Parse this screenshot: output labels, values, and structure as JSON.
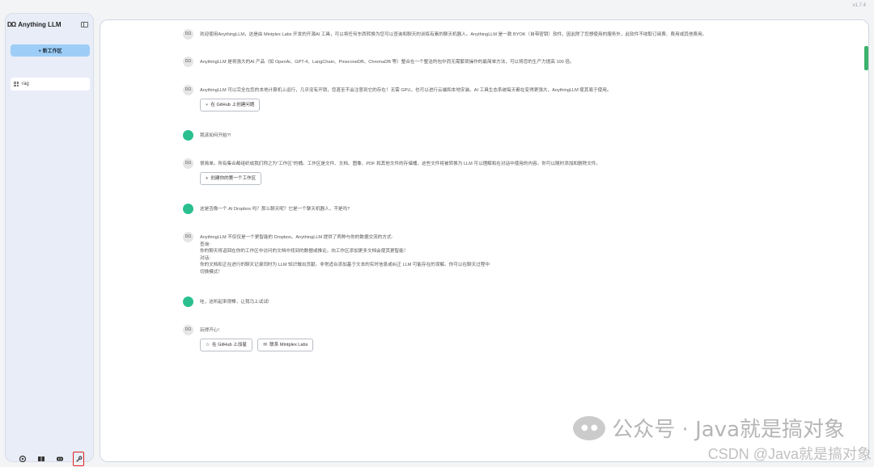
{
  "version": "v1.7.4",
  "brand": {
    "logo_glyph": "DΩ",
    "name": "Anything LLM"
  },
  "sidebar": {
    "new_workspace": "+ 新工作区",
    "workspaces": [
      {
        "name": "rag"
      }
    ],
    "bottom_icons": [
      "community-icon",
      "docs-icon",
      "discord-icon",
      "settings-wrench-icon"
    ]
  },
  "messages": [
    {
      "role": "ai",
      "avatar_text": "DΩ",
      "text": "欢迎使用AnythingLLM，这是由 Mintplex Labs 开发的开源AI 工具，可以将任何东西转换为您可以查询和聊天的训练有素的聊天机器人。AnythingLLM 是一款 BYOK（自带密钥）软件，因此除了您想使用的服务外，此软件不收取订阅费、费用或其他费用。"
    },
    {
      "role": "ai",
      "avatar_text": "DΩ",
      "text": "AnythingLLM 是将强大的AI 产品（如 OpenAi、GPT-4、LangChain、PineconeDB、ChromaDB 等）整合在一个整洁的包中而无需繁琐操作的最简单方法，可以将您的生产力提高 100 倍。"
    },
    {
      "role": "ai",
      "avatar_text": "DΩ",
      "text": "AnythingLLM 可以完全在您的本地计算机上运行，几乎没有开销，您甚至不会注意到它的存在！无需 GPU，也可以进行云端和本地安装。AI 工具生态系统每天都在变得更强大，AnythingLLM 使其易于使用。",
      "buttons": [
        {
          "icon": "⑂",
          "label": "在 GitHub 上创建问题"
        }
      ]
    },
    {
      "role": "user",
      "avatar_text": "",
      "text": "我该如何开始?!"
    },
    {
      "role": "ai",
      "avatar_text": "DΩ",
      "text": "很简单。所有集合都组织成我们称之为\"工作区\"的桶。工作区是文件、文档、图像、PDF 和其他文件的存储桶，这些文件将被转换为 LLM 可以理解和在对话中使用的内容。你可以随时添加和删除文件。",
      "buttons": [
        {
          "icon": "+",
          "label": "创建你的第一个工作区"
        }
      ]
    },
    {
      "role": "user",
      "avatar_text": "",
      "text": "这是否像一个 AI Dropbox 吗？那么聊天呢？它是一个聊天机器人，不是吗?"
    },
    {
      "role": "ai",
      "avatar_text": "DΩ",
      "lines": [
        "AnythingLLM 不仅仅是一个更智能的 Dropbox。AnythingLLM 提供了两种与你的数据交流的方式:",
        "查询:",
        "你的聊天将返回在你的工作区中访问的文档中找到的数据或推论。向工作区添加更多文档会使其更智能！",
        "对话:",
        "你的文档和正在进行的聊天记录同时为 LLM 知识做出贡献。非常适合添加基于文本的实时信息或纠正 LLM 可能存在的误解。你可以在聊天过程中",
        "切换模式！"
      ]
    },
    {
      "role": "user",
      "avatar_text": "",
      "text": "哇，这听起来很棒，让我马上试试!"
    },
    {
      "role": "ai",
      "avatar_text": "DΩ",
      "text": "玩得开心!",
      "buttons": [
        {
          "icon": "☆",
          "label": "在 GitHub 上加星"
        },
        {
          "icon": "✉",
          "label": "联系 Mintplex Labs"
        }
      ]
    }
  ],
  "watermark": {
    "text": "公众号 · Java就是搞对象",
    "csdn": "CSDN @Java就是搞对象"
  }
}
